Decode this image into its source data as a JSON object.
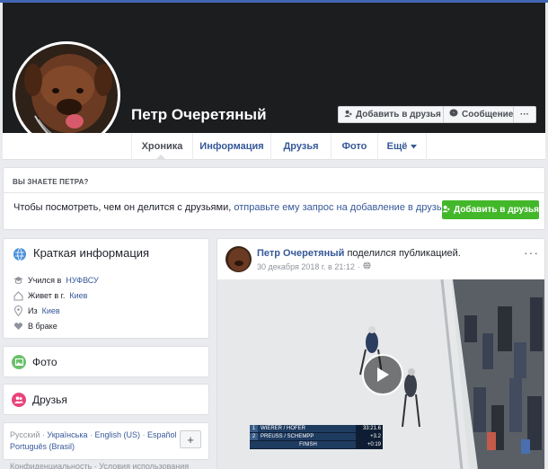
{
  "profile": {
    "name": "Петр Очеретяный",
    "add_friend_label": "Добавить в друзья",
    "message_label": "Сообщение",
    "more_label": "···"
  },
  "nav": {
    "tabs": [
      {
        "label": "Хроника"
      },
      {
        "label": "Информация"
      },
      {
        "label": "Друзья"
      },
      {
        "label": "Фото"
      },
      {
        "label": "Ещё"
      }
    ]
  },
  "know": {
    "title": "ВЫ ЗНАЕТЕ ПЕТРА?",
    "text_prefix": "Чтобы посмотреть, чем он делится с друзьями,",
    "text_link": "отправьте ему запрос на добавление в друзья.",
    "button_label": "Добавить в друзья"
  },
  "intro": {
    "title": "Краткая информация",
    "rows": [
      {
        "prefix": "Учился в",
        "link": "НУФВСУ"
      },
      {
        "prefix": "Живет в г.",
        "link": "Киев"
      },
      {
        "prefix": "Из",
        "link": "Киев"
      },
      {
        "prefix": "В браке",
        "link": ""
      }
    ]
  },
  "photos": {
    "title": "Фото"
  },
  "friends": {
    "title": "Друзья"
  },
  "languages": {
    "current": "Русский",
    "items": [
      "Українська",
      "English (US)",
      "Español",
      "Português (Brasil)"
    ],
    "plus": "+"
  },
  "footer": {
    "text": "Конфиденциальность · Условия использования"
  },
  "post": {
    "author": "Петр Очеретяный",
    "action": "поделился публикацией.",
    "date": "30 декабря 2018 г. в 21:12",
    "more": "···",
    "video": {
      "scoreboard": [
        {
          "num": "1",
          "name": "WIERER / HOFER",
          "time": "33:21.6"
        },
        {
          "num": "2",
          "name": "PREUSS / SCHEMPP",
          "time": "+3.2"
        },
        {
          "num": "",
          "name": "FINISH",
          "time": "+0:19"
        }
      ]
    }
  },
  "colors": {
    "link": "#365899",
    "green": "#42b72a",
    "cover": "#1c1d1f",
    "photos_icon": "#6bc06b",
    "friends_icon": "#e9447b"
  }
}
